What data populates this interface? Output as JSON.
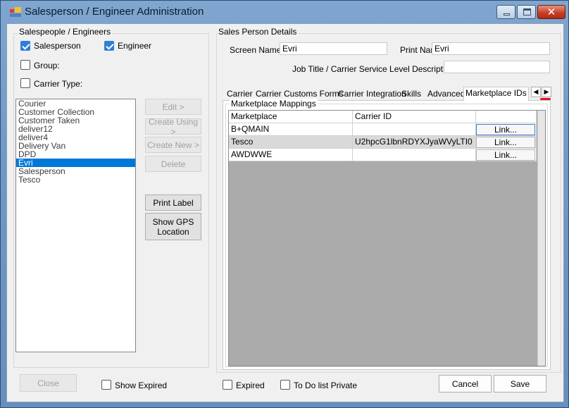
{
  "window": {
    "title": "Salesperson / Engineer Administration"
  },
  "left_panel": {
    "group_title": "Salespeople / Engineers",
    "salesperson_checkbox": {
      "label": "Salesperson",
      "checked": true
    },
    "engineer_checkbox": {
      "label": "Engineer",
      "checked": true
    },
    "group_checkbox": {
      "label": "Group:",
      "checked": false
    },
    "carrier_type_checkbox": {
      "label": "Carrier Type:",
      "checked": false
    },
    "list_items": [
      {
        "label": "Courier",
        "selected": false
      },
      {
        "label": "Customer Collection",
        "selected": false
      },
      {
        "label": "Customer Taken",
        "selected": false
      },
      {
        "label": "deliver12",
        "selected": false
      },
      {
        "label": "deliver4",
        "selected": false
      },
      {
        "label": "Delivery Van",
        "selected": false
      },
      {
        "label": "DPD",
        "selected": false
      },
      {
        "label": "Evri",
        "selected": true
      },
      {
        "label": "Salesperson",
        "selected": false
      },
      {
        "label": "Tesco",
        "selected": false
      }
    ],
    "buttons": {
      "edit": "Edit >",
      "create_using": "Create Using >",
      "create_new": "Create New >",
      "delete": "Delete",
      "print_label": "Print Label",
      "show_gps": "Show GPS Location"
    }
  },
  "details": {
    "group_title": "Sales Person Details",
    "screen_name_label": "Screen Name:",
    "screen_name_value": "Evri",
    "print_name_label": "Print Name:",
    "print_name_value": "Evri",
    "job_title_label": "Job Title / Carrier Service Level Description:",
    "job_title_value": ""
  },
  "tabs": [
    {
      "label": "Carrier",
      "active": false
    },
    {
      "label": "Carrier Customs Forms",
      "active": false
    },
    {
      "label": "Carrier Integration",
      "active": false
    },
    {
      "label": "Skills",
      "active": false
    },
    {
      "label": "Advanced",
      "active": false
    },
    {
      "label": "Marketplace IDs",
      "active": true
    }
  ],
  "tab_scroll": {
    "left_icon": "triangle-left-icon",
    "right_icon": "triangle-right-icon"
  },
  "marketplace": {
    "group_title": "Marketplace Mappings",
    "columns": [
      "Marketplace",
      "Carrier ID",
      ""
    ],
    "rows": [
      {
        "marketplace": "B+QMAIN",
        "carrier_id": "",
        "action": "Link..."
      },
      {
        "marketplace": "Tesco",
        "carrier_id": "U2hpcG1lbnRDYXJyaWVyLTI0",
        "action": "Link..."
      },
      {
        "marketplace": "AWDWWE",
        "carrier_id": "",
        "action": "Link..."
      }
    ]
  },
  "footer": {
    "close": "Close",
    "show_expired": {
      "label": "Show Expired",
      "checked": false
    },
    "expired": {
      "label": "Expired",
      "checked": false
    },
    "todo_private": {
      "label": "To Do list Private",
      "checked": false
    },
    "cancel": "Cancel",
    "save": "Save"
  },
  "colors": {
    "selection": "#0078d7",
    "annotation": "#e0141e",
    "check_accent": "#2f7fd6"
  }
}
